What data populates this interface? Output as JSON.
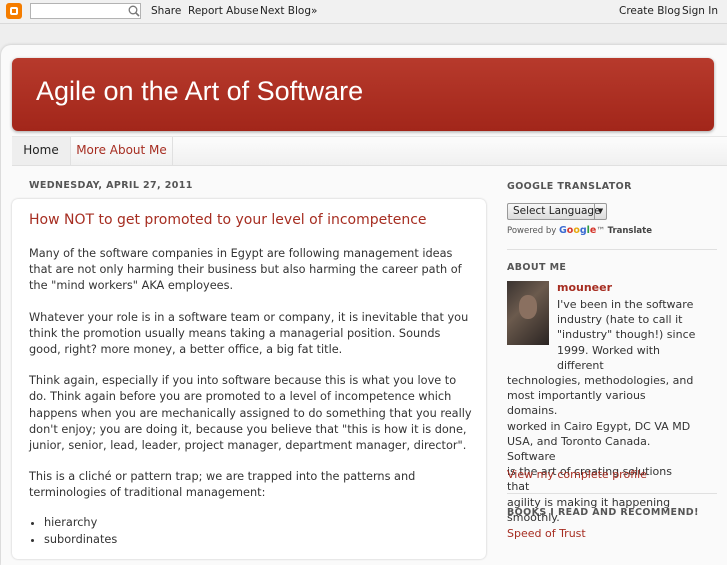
{
  "navbar": {
    "share": "Share",
    "report_abuse": "Report Abuse",
    "next_blog": "Next Blog»",
    "create_blog": "Create Blog",
    "sign_in": "Sign In",
    "search_value": ""
  },
  "header": {
    "title": "Agile on the Art of Software"
  },
  "tabs": [
    {
      "label": "Home",
      "active": true
    },
    {
      "label": "More About Me",
      "active": false
    }
  ],
  "post": {
    "date": "WEDNESDAY, APRIL 27, 2011",
    "title": "How NOT to get promoted to your level of incompetence",
    "paragraphs": [
      "Many of the software companies in Egypt are following management ideas that are not only harming their business but also harming the career path of the \"mind workers\" AKA employees.",
      "Whatever your role is in a software team or company, it is inevitable that you think the promotion usually means taking a managerial position. Sounds good, right? more money, a better office, a big fat title.",
      "Think again, especially if you into software because this is what you love to do. Think again before you are promoted to a level of incompetence which happens when you are mechanically assigned to do something that you really don't enjoy; you are doing it, because you believe that \"this is how it is done, junior, senior, lead, leader, project manager, department manager, director\".",
      "This is a cliché or pattern trap; we are trapped into the patterns and terminologies of traditional management:"
    ],
    "list": [
      "hierarchy",
      "subordinates"
    ]
  },
  "sidebar": {
    "translator": {
      "title": "GOOGLE TRANSLATOR",
      "select_label": "Select Language",
      "powered_by": "Powered by",
      "google": [
        "G",
        "o",
        "o",
        "g",
        "l",
        "e"
      ],
      "tm": "™",
      "translate": "Translate"
    },
    "about": {
      "title": "ABOUT ME",
      "name": "mouneer",
      "text_lines": [
        "I've been in the software",
        "industry (hate to call it",
        "\"industry\" though!) since",
        "1999. Worked with different",
        "technologies, methodologies, and",
        "most importantly various domains.",
        "worked in Cairo Egypt, DC VA MD",
        "USA, and Toronto Canada. Software",
        "is the art of creating solutions that",
        "agility is making it happening",
        "smoothly."
      ],
      "profile_link": "View my complete profile"
    },
    "books": {
      "title": "BOOKS I READ AND RECOMMEND!",
      "items": [
        "Speed of Trust"
      ]
    }
  },
  "colors": {
    "header_red": "#b73a2c",
    "link_red": "#a62d21",
    "blogger_orange": "#f57d00"
  }
}
